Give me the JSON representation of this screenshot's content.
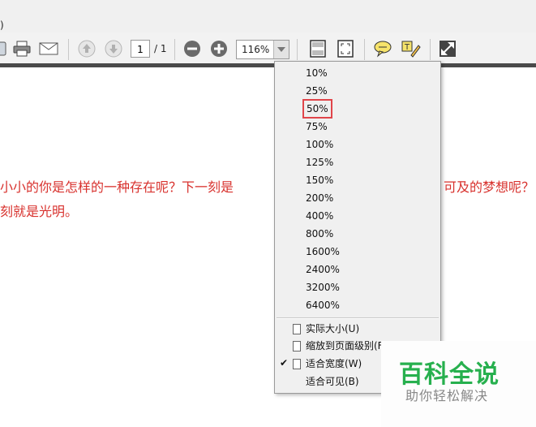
{
  "menubar": {
    "cut_text": ")"
  },
  "toolbar": {
    "page_current": "1",
    "page_total": "/ 1",
    "zoom_value": "116%"
  },
  "document": {
    "line1_left": "小小的你是怎样的一种存在呢？下一刻是",
    "line1_right": "可及的梦想呢？",
    "line2": "刻就是光明。"
  },
  "zoom_menu": {
    "levels": [
      "10%",
      "25%",
      "50%",
      "75%",
      "100%",
      "125%",
      "150%",
      "200%",
      "400%",
      "800%",
      "1600%",
      "2400%",
      "3200%",
      "6400%"
    ],
    "highlighted": "50%",
    "fit_options": [
      "实际大小(U)",
      "缩放到页面级别(F)",
      "适合宽度(W)",
      "适合可见(B)"
    ],
    "checked_option": "适合宽度(W)"
  },
  "watermark": {
    "title": "百科全说",
    "subtitle": "助你轻松解决",
    "color": "#27b04e"
  },
  "colors": {
    "doc_text": "#d8322e",
    "highlight": "#e0454a"
  }
}
